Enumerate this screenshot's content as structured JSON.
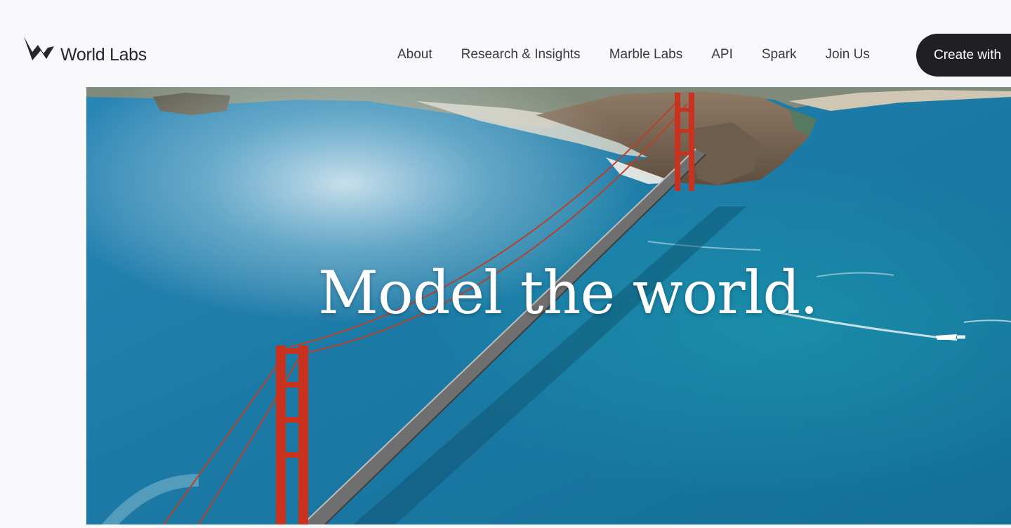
{
  "brand": {
    "name": "World Labs",
    "logo_icon": "world-labs-mark-icon",
    "color": "#26262b"
  },
  "nav": {
    "items": [
      {
        "label": "About"
      },
      {
        "label": "Research & Insights"
      },
      {
        "label": "Marble Labs"
      },
      {
        "label": "API"
      },
      {
        "label": "Spark"
      },
      {
        "label": "Join Us"
      }
    ],
    "cta_label": "Create with"
  },
  "hero": {
    "headline": "Model the world.",
    "image_subject": "aerial view of the Golden Gate Bridge over blue ocean"
  },
  "colors": {
    "background": "#f8f8fa",
    "cta_background": "#1f1f24",
    "ocean": "#1d7ea3",
    "bridge": "#c8321e"
  }
}
